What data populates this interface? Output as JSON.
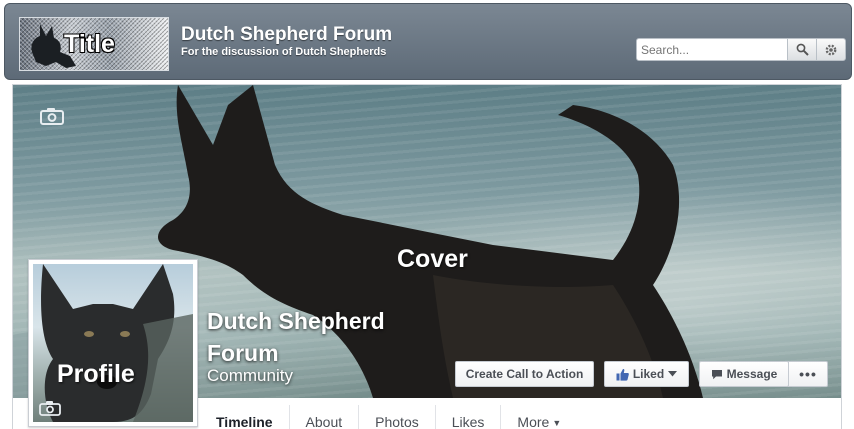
{
  "header": {
    "logo_text": "Title",
    "title": "Dutch Shepherd Forum",
    "subtitle": "For the discussion of Dutch Shepherds",
    "search_placeholder": "Search...",
    "search_icon": "search-icon",
    "settings_icon": "gear-icon"
  },
  "cover": {
    "label": "Cover",
    "camera_icon": "camera-icon"
  },
  "page": {
    "name": "Dutch Shepherd Forum",
    "category": "Community"
  },
  "profile": {
    "label": "Profile",
    "camera_icon": "camera-icon"
  },
  "actions": {
    "cta_label": "Create Call to Action",
    "liked_label": "Liked",
    "message_label": "Message",
    "more_label": "•••"
  },
  "tabs": [
    {
      "label": "Timeline",
      "active": true
    },
    {
      "label": "About"
    },
    {
      "label": "Photos"
    },
    {
      "label": "Likes"
    },
    {
      "label": "More"
    }
  ],
  "colors": {
    "header": "#6b7784",
    "like_blue": "#4267b2",
    "text_dark": "#4b4f56"
  }
}
